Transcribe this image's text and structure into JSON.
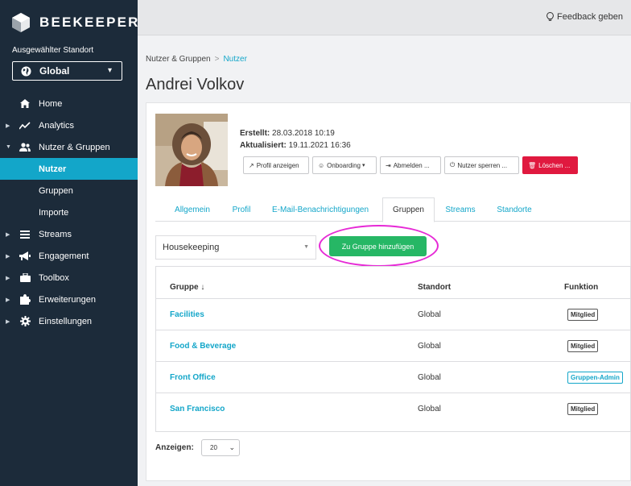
{
  "brand": {
    "name": "BEEKEEPER"
  },
  "location": {
    "label": "Ausgewählter Standort",
    "value": "Global"
  },
  "nav": {
    "items": [
      {
        "label": "Home",
        "icon": "home-icon"
      },
      {
        "label": "Analytics",
        "icon": "analytics-icon"
      },
      {
        "label": "Nutzer & Gruppen",
        "icon": "users-icon"
      },
      {
        "label": "Nutzer"
      },
      {
        "label": "Gruppen"
      },
      {
        "label": "Importe"
      },
      {
        "label": "Streams",
        "icon": "streams-icon"
      },
      {
        "label": "Engagement",
        "icon": "megaphone-icon"
      },
      {
        "label": "Toolbox",
        "icon": "toolbox-icon"
      },
      {
        "label": "Erweiterungen",
        "icon": "puzzle-icon"
      },
      {
        "label": "Einstellungen",
        "icon": "gear-icon"
      }
    ]
  },
  "topbar": {
    "feedback": "Feedback geben"
  },
  "breadcrumb": {
    "parent": "Nutzer & Gruppen",
    "separator": ">",
    "current": "Nutzer"
  },
  "page": {
    "title": "Andrei Volkov"
  },
  "meta": {
    "created_label": "Erstellt:",
    "created_value": "28.03.2018 10:19",
    "updated_label": "Aktualisiert:",
    "updated_value": "19.11.2021 16:36"
  },
  "actions": {
    "profile": "Profil anzeigen",
    "onboarding": "Onboarding",
    "logout": "Abmelden ...",
    "block": "Nutzer sperren ...",
    "delete": "Löschen ..."
  },
  "tabs": [
    "Allgemein",
    "Profil",
    "E-Mail-Benachrichtigungen",
    "Gruppen",
    "Streams",
    "Standorte"
  ],
  "groups": {
    "selected": "Housekeeping",
    "add_button": "Zu Gruppe hinzufügen",
    "headers": {
      "group": "Gruppe",
      "location": "Standort",
      "role": "Funktion"
    },
    "rows": [
      {
        "name": "Facilities",
        "location": "Global",
        "role": "Mitglied"
      },
      {
        "name": "Food & Beverage",
        "location": "Global",
        "role": "Mitglied"
      },
      {
        "name": "Front Office",
        "location": "Global",
        "role": "Gruppen-Admin"
      },
      {
        "name": "San Francisco",
        "location": "Global",
        "role": "Mitglied"
      }
    ],
    "per_page_label": "Anzeigen:",
    "per_page_value": "20"
  },
  "colors": {
    "sidebar": "#1c2b3a",
    "accent": "#13a6c9",
    "success": "#26b765",
    "danger": "#e0193f",
    "highlight": "#e62ad6"
  }
}
